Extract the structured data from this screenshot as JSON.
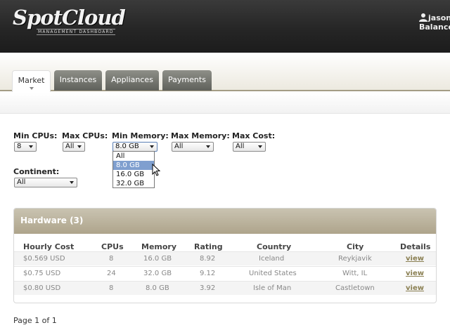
{
  "header": {
    "logo_text": "SpotCloud",
    "logo_subtitle": "MANAGEMENT DASHBOARD",
    "username": "jasonl",
    "balance_label": "Balance:"
  },
  "tabs": [
    {
      "label": "Market",
      "active": true
    },
    {
      "label": "Instances",
      "active": false
    },
    {
      "label": "Appliances",
      "active": false
    },
    {
      "label": "Payments",
      "active": false
    }
  ],
  "filters": {
    "min_cpus": {
      "label": "Min CPUs:",
      "value": "8"
    },
    "max_cpus": {
      "label": "Max CPUs:",
      "value": "All"
    },
    "min_memory": {
      "label": "Min Memory:",
      "value": "8.0 GB",
      "options": [
        "All",
        "8.0 GB",
        "16.0 GB",
        "32.0 GB"
      ],
      "highlighted": "8.0 GB"
    },
    "max_memory": {
      "label": "Max Memory:",
      "value": "All"
    },
    "max_cost": {
      "label": "Max Cost:",
      "value": "All"
    },
    "continent": {
      "label": "Continent:",
      "value": "All"
    }
  },
  "hardware": {
    "title": "Hardware (3)",
    "columns": [
      "Hourly Cost",
      "CPUs",
      "Memory",
      "Rating",
      "Country",
      "City",
      "Details"
    ],
    "rows": [
      {
        "cost": "$0.569 USD",
        "cpus": "8",
        "memory": "16.0 GB",
        "rating": "8.92",
        "country": "Iceland",
        "city": "Reykjavik",
        "details": "view"
      },
      {
        "cost": "$0.75 USD",
        "cpus": "24",
        "memory": "32.0 GB",
        "rating": "9.12",
        "country": "United States",
        "city": "Witt, IL",
        "details": "view"
      },
      {
        "cost": "$0.80 USD",
        "cpus": "8",
        "memory": "8.0 GB",
        "rating": "3.92",
        "country": "Isle of Man",
        "city": "Castletown",
        "details": "view"
      }
    ]
  },
  "pager": {
    "text": "Page 1 of 1"
  },
  "colors": {
    "header_bg": "#262626",
    "accent_tan": "#aea48b",
    "link": "#8a7f52",
    "dropdown_highlight": "#7f9fcf"
  }
}
